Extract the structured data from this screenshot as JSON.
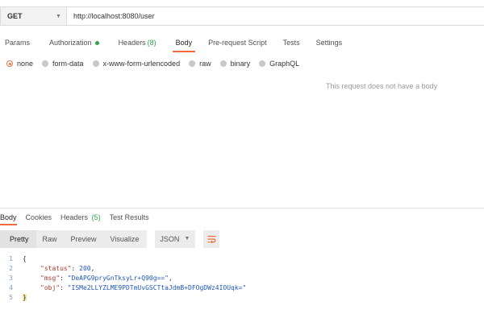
{
  "request": {
    "method": "GET",
    "url": "http://localhost:8080/user"
  },
  "request_tabs": [
    {
      "label": "Params"
    },
    {
      "label": "Authorization"
    },
    {
      "label": "Headers",
      "count": "(8)"
    },
    {
      "label": "Body"
    },
    {
      "label": "Pre-request Script"
    },
    {
      "label": "Tests"
    },
    {
      "label": "Settings"
    }
  ],
  "body_types": [
    "none",
    "form-data",
    "x-www-form-urlencoded",
    "raw",
    "binary",
    "GraphQL"
  ],
  "body_empty_message": "This request does not have a body",
  "response_tabs": [
    {
      "label": "Body"
    },
    {
      "label": "Cookies"
    },
    {
      "label": "Headers",
      "count": "(5)"
    },
    {
      "label": "Test Results"
    }
  ],
  "view_modes": [
    "Pretty",
    "Raw",
    "Preview",
    "Visualize"
  ],
  "format": "JSON",
  "response_lines": {
    "n1": "1",
    "n2": "2",
    "n3": "3",
    "n4": "4",
    "n5": "5",
    "open": "{",
    "close": "}",
    "status_key": "\"status\"",
    "status_value": "200",
    "msg_key": "\"msg\"",
    "msg_value": "\"DeAPG9pryGnTksyLr+Q90g==\"",
    "obj_key": "\"obj\"",
    "obj_value": "\"ISMe2LLYZLME9PDTmUvGSCTtaJdmB+DFOgDWz4IOUqk=\""
  },
  "colors": {
    "accent": "#f26b3a",
    "auth_dot": "#2ea44f",
    "json_key": "#a33a2a",
    "json_value": "#1f58b8"
  }
}
